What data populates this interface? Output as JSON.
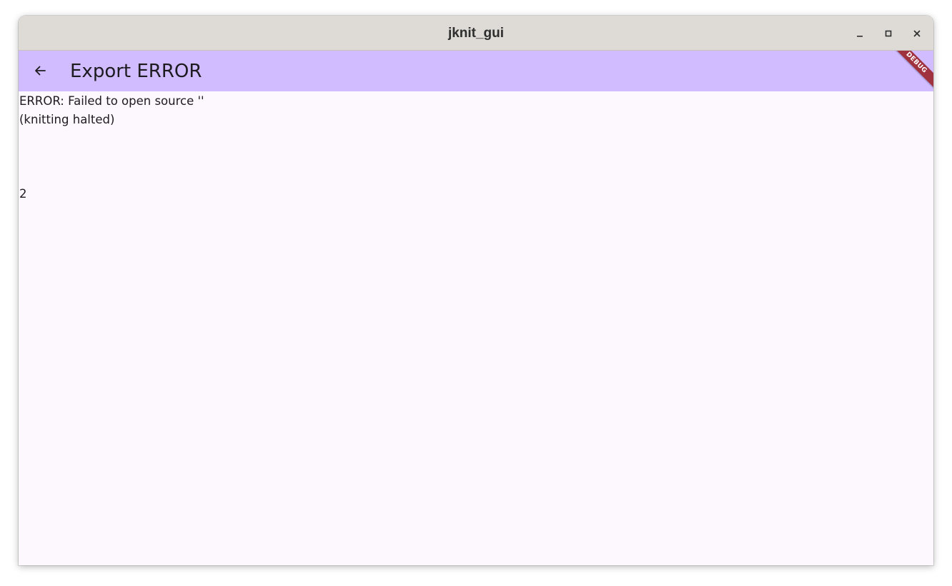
{
  "window": {
    "title": "jknit_gui"
  },
  "appbar": {
    "title": "Export ERROR",
    "back_icon": "arrow-left-icon",
    "background": "#d0bcff"
  },
  "debug_banner": {
    "label": "DEBUG",
    "color": "#a0313f"
  },
  "content": {
    "error_message": "ERROR: Failed to open source ''",
    "status_message": "(knitting halted)",
    "exit_code": "2",
    "background": "#fdf7fe"
  },
  "icons": {
    "minimize": "minimize-icon",
    "maximize": "maximize-icon",
    "close": "close-icon"
  }
}
